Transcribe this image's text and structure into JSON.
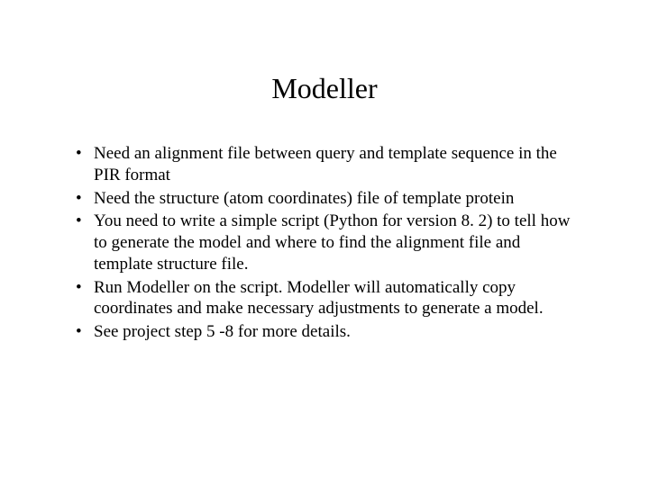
{
  "title": "Modeller",
  "bullets": [
    "Need an alignment file between query and template sequence in the PIR format",
    "Need the structure (atom coordinates) file of template protein",
    "You need to write a simple script (Python for version 8. 2) to tell how to generate the model and where to find the alignment file and template structure file.",
    "Run Modeller on the script. Modeller will automatically copy coordinates and make necessary adjustments to generate a model.",
    "See project step 5 -8 for more details."
  ]
}
